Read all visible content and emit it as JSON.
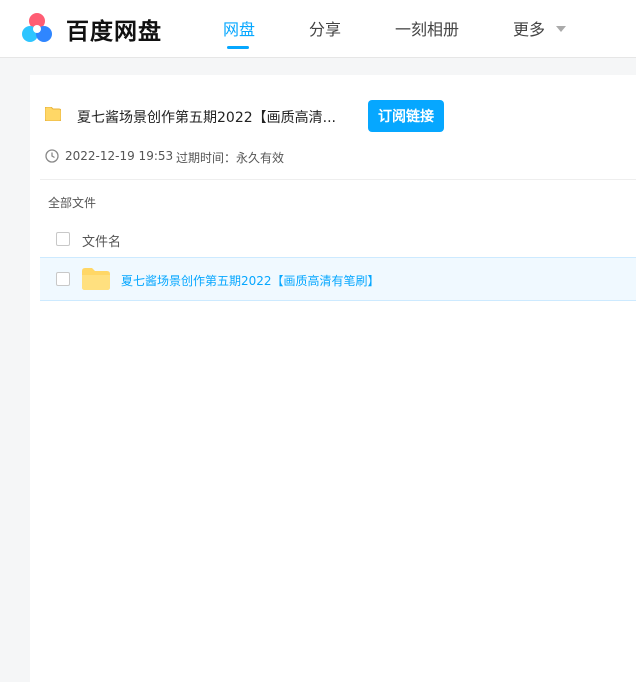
{
  "brand": {
    "name": "百度网盘"
  },
  "nav": [
    {
      "label": "网盘"
    },
    {
      "label": "分享"
    },
    {
      "label": "一刻相册"
    },
    {
      "label": "更多"
    }
  ],
  "share": {
    "title": "夏七酱场景创作第五期2022【画质高清...",
    "subscribe_label": "订阅链接",
    "date": "2022-12-19 19:53",
    "expire": "过期时间：永久有效"
  },
  "breadcrumb": "全部文件",
  "table": {
    "header": "文件名",
    "rows": [
      {
        "name": "夏七酱场景创作第五期2022【画质高清有笔刷】"
      }
    ]
  },
  "colors": {
    "accent": "#06a7ff",
    "folder": "#ffd766"
  }
}
